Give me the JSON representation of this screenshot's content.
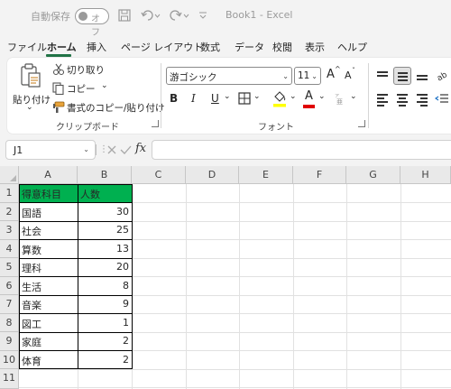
{
  "titlebar": {
    "autosave_label": "自動保存",
    "autosave_state": "オフ",
    "save_icon": "save-icon",
    "undo_icon": "undo-icon",
    "redo_icon": "redo-icon",
    "customize_icon": "customize-icon",
    "document_title": "Book1 - Excel"
  },
  "tabs": [
    "ファイル",
    "ホーム",
    "挿入",
    "ページ レイアウト",
    "数式",
    "データ",
    "校閲",
    "表示",
    "ヘルプ"
  ],
  "ribbon": {
    "clipboard": {
      "paste_label": "貼り付け",
      "paste_arrow": "⌄",
      "cut_label": "切り取り",
      "copy_label": "コピー",
      "copy_arrow": "⌄",
      "format_painter_label": "書式のコピー/貼り付け",
      "group_label": "クリップボード"
    },
    "font": {
      "font_name": "游ゴシック",
      "font_size": "11",
      "grow_glyph": "A",
      "shrink_glyph": "A",
      "bold": "B",
      "italic": "I",
      "underline": "U",
      "font_color_glyph": "A",
      "group_label": "フォント"
    },
    "colors": {
      "fill_color": "#ffff00",
      "font_color": "#e00000"
    }
  },
  "formula_bar": {
    "name_box": "J1",
    "fx_label": "fx",
    "formula": ""
  },
  "sheet": {
    "columns": [
      "A",
      "B",
      "C",
      "D",
      "E",
      "F",
      "G",
      "H"
    ],
    "rows": [
      "1",
      "2",
      "3",
      "4",
      "5",
      "6",
      "7",
      "8",
      "9",
      "10",
      "11"
    ],
    "header": [
      "得意科目",
      "人数"
    ],
    "header_fill": "#00b050",
    "data": [
      [
        "国語",
        "30"
      ],
      [
        "社会",
        "25"
      ],
      [
        "算数",
        "13"
      ],
      [
        "理科",
        "20"
      ],
      [
        "生活",
        "8"
      ],
      [
        "音楽",
        "9"
      ],
      [
        "図工",
        "1"
      ],
      [
        "家庭",
        "2"
      ],
      [
        "体育",
        "2"
      ]
    ]
  },
  "accent_color": "#217346"
}
